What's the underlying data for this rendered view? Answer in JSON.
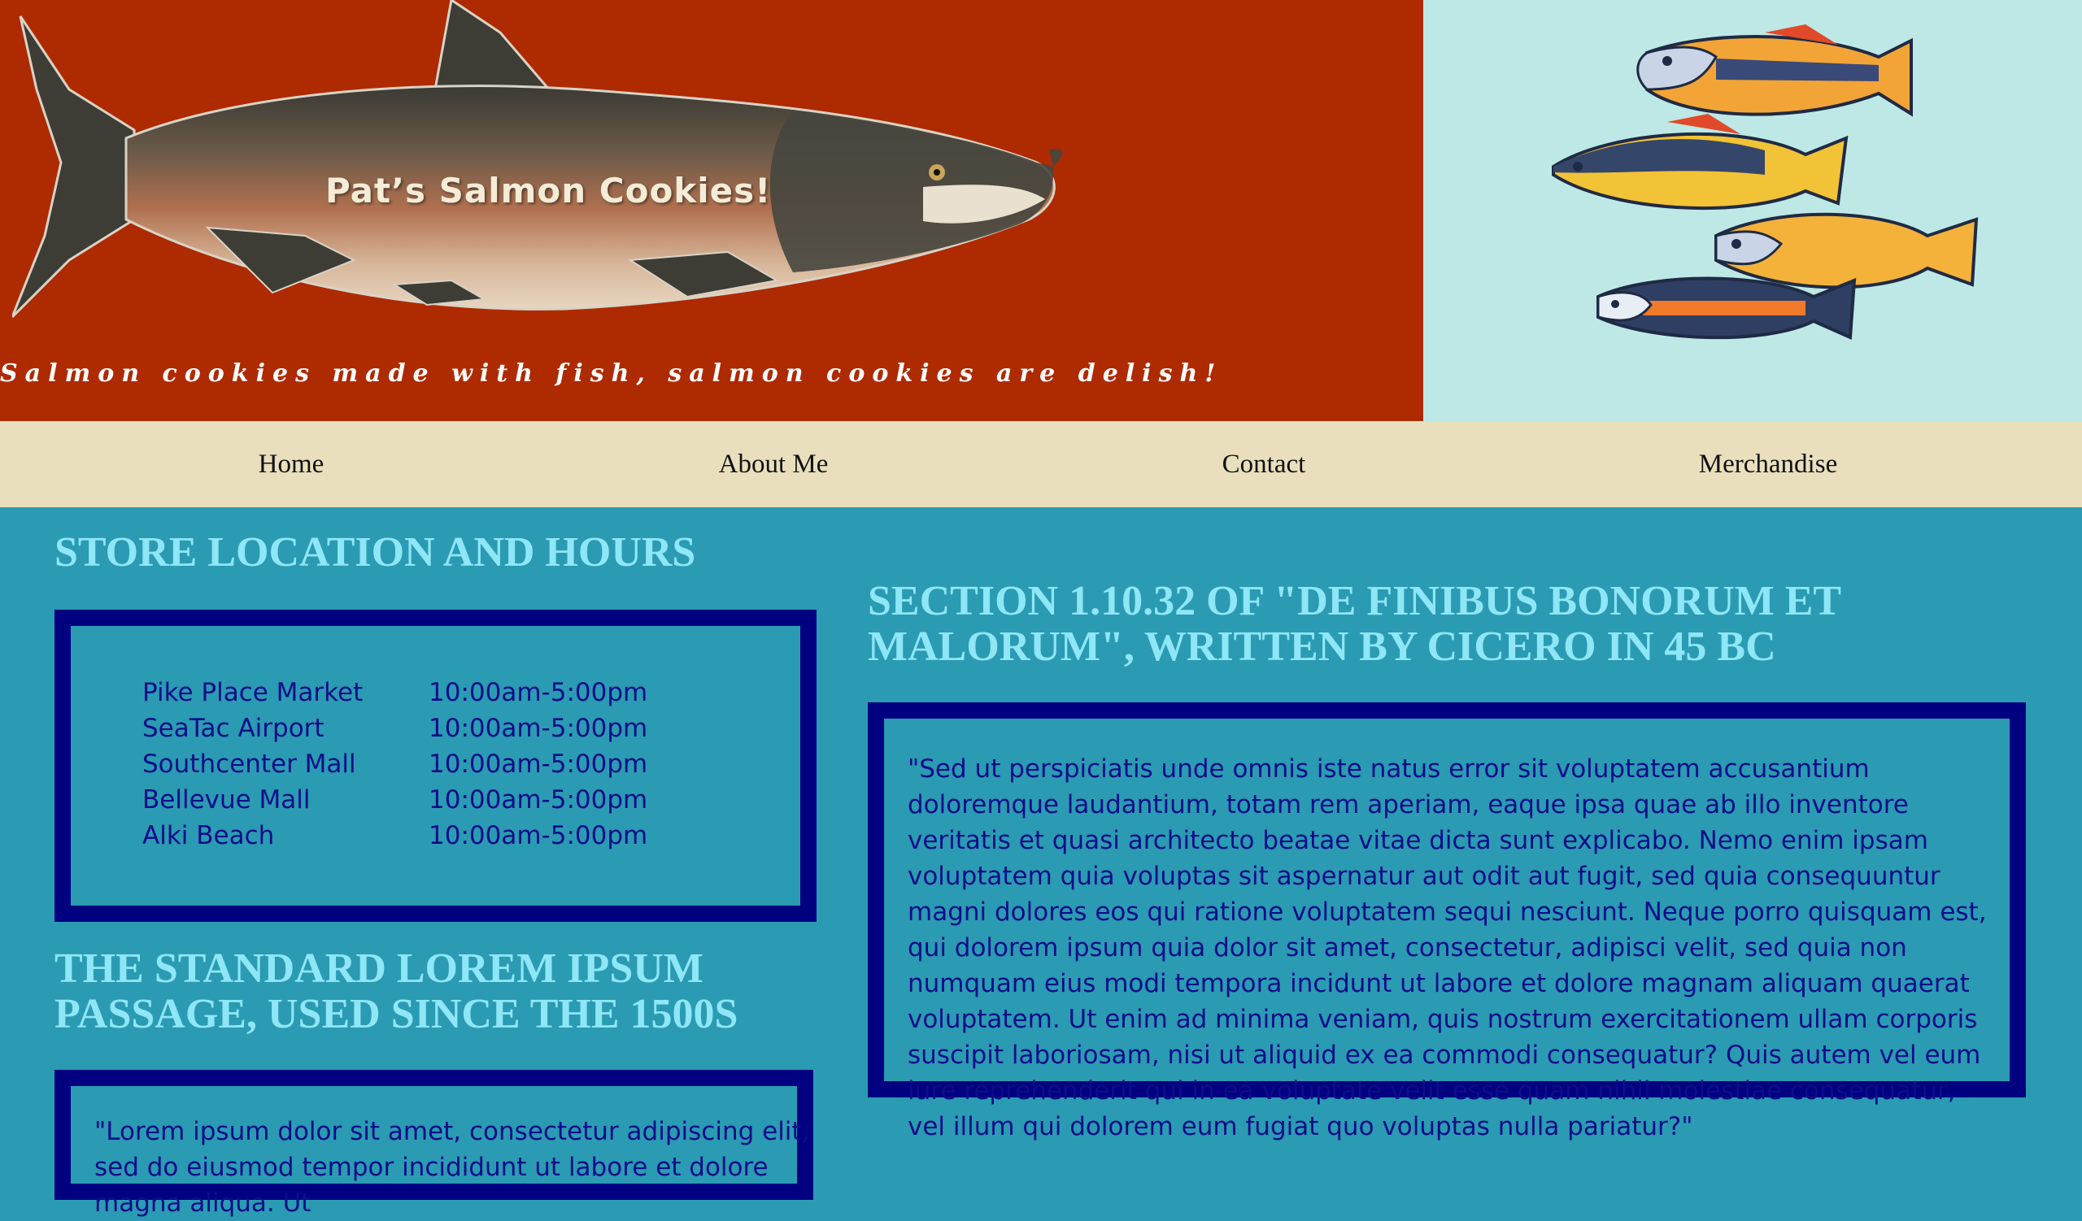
{
  "header": {
    "title": "Pat’s Salmon Cookies!",
    "tagline": "Salmon cookies made with fish, salmon cookies are delish!",
    "left_bg": "#ae2a00",
    "right_bg": "#bde8e6"
  },
  "nav": {
    "items": [
      {
        "label": "Home"
      },
      {
        "label": "About Me"
      },
      {
        "label": "Contact"
      },
      {
        "label": "Merchandise"
      }
    ]
  },
  "store": {
    "heading": "STORE LOCATION AND HOURS",
    "locations": [
      {
        "name": "Pike Place Market",
        "hours": "10:00am-5:00pm"
      },
      {
        "name": "SeaTac Airport",
        "hours": "10:00am-5:00pm"
      },
      {
        "name": "Southcenter Mall",
        "hours": "10:00am-5:00pm"
      },
      {
        "name": "Bellevue Mall",
        "hours": "10:00am-5:00pm"
      },
      {
        "name": "Alki Beach",
        "hours": "10:00am-5:00pm"
      }
    ]
  },
  "lorem": {
    "heading": "THE STANDARD LOREM IPSUM PASSAGE, USED SINCE THE 1500S",
    "text": "\"Lorem ipsum dolor sit amet, consectetur adipiscing elit, sed do eiusmod tempor incididunt ut labore et dolore magna aliqua. Ut"
  },
  "cicero": {
    "heading": "SECTION 1.10.32 OF \"DE FINIBUS BONORUM ET MALORUM\", WRITTEN BY CICERO IN 45 BC",
    "text": "\"Sed ut perspiciatis unde omnis iste natus error sit voluptatem accusantium doloremque laudantium, totam rem aperiam, eaque ipsa quae ab illo inventore veritatis et quasi architecto beatae vitae dicta sunt explicabo. Nemo enim ipsam voluptatem quia voluptas sit aspernatur aut odit aut fugit, sed quia consequuntur magni dolores eos qui ratione voluptatem sequi nesciunt. Neque porro quisquam est, qui dolorem ipsum quia dolor sit amet, consectetur, adipisci velit, sed quia non numquam eius modi tempora incidunt ut labore et dolore magnam aliquam quaerat voluptatem. Ut enim ad minima veniam, quis nostrum exercitationem ullam corporis suscipit laboriosam, nisi ut aliquid ex ea commodi consequatur? Quis autem vel eum iure reprehenderit qui in ea voluptate velit esse quam nihil molestiae consequatur, vel illum qui dolorem eum fugiat quo voluptas nulla pariatur?\""
  },
  "colors": {
    "page_bg": "#2a9bb2",
    "nav_bg": "#e9dfbc",
    "heading": "#8ee6f6",
    "box_border": "#000080",
    "box_text": "#0d0d8a"
  }
}
